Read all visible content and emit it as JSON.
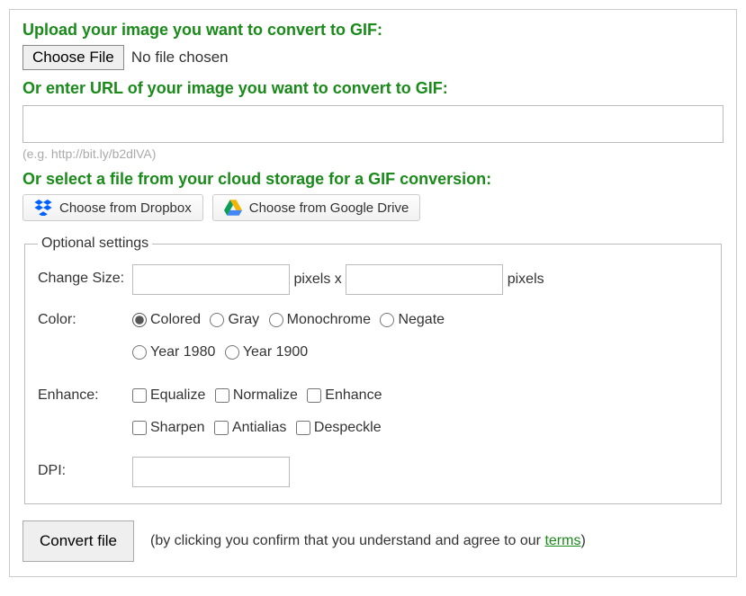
{
  "upload": {
    "heading": "Upload your image you want to convert to GIF:",
    "choose_label": "Choose File",
    "status": "No file chosen"
  },
  "url": {
    "heading": "Or enter URL of your image you want to convert to GIF:",
    "value": "",
    "hint": "(e.g. http://bit.ly/b2dlVA)"
  },
  "cloud": {
    "heading": "Or select a file from your cloud storage for a GIF conversion:",
    "dropbox_label": "Choose from Dropbox",
    "gdrive_label": "Choose from Google Drive"
  },
  "optional": {
    "legend": "Optional settings",
    "size": {
      "label": "Change Size:",
      "width": "",
      "sep": "pixels x",
      "height": "",
      "suffix": "pixels"
    },
    "color": {
      "label": "Color:",
      "options": [
        "Colored",
        "Gray",
        "Monochrome",
        "Negate",
        "Year 1980",
        "Year 1900"
      ],
      "selected": "Colored"
    },
    "enhance": {
      "label": "Enhance:",
      "options": [
        "Equalize",
        "Normalize",
        "Enhance",
        "Sharpen",
        "Antialias",
        "Despeckle"
      ]
    },
    "dpi": {
      "label": "DPI:",
      "value": ""
    }
  },
  "submit": {
    "button": "Convert file",
    "note_pre": "(by clicking you confirm that you understand and agree to our ",
    "terms": "terms",
    "note_post": ")"
  }
}
